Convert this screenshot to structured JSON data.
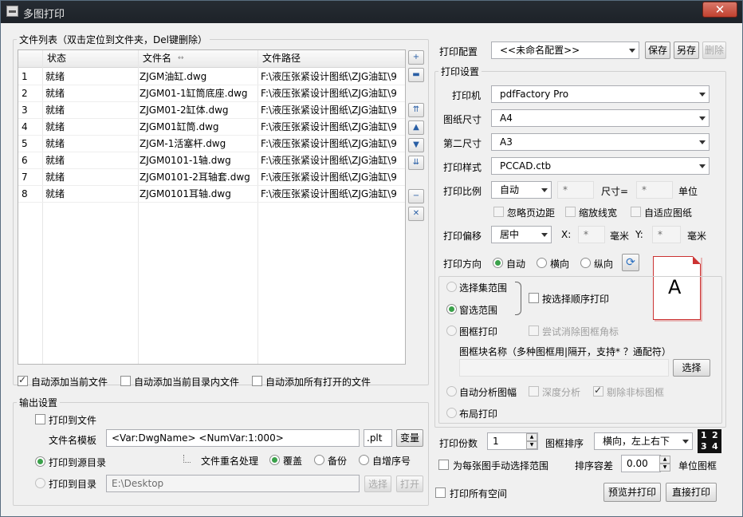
{
  "window": {
    "title": "多图打印",
    "close": "✕"
  },
  "file_list": {
    "legend": "文件列表（双击定位到文件夹，Del键删除）",
    "columns": [
      "状态",
      "文件名",
      "文件路径"
    ],
    "sort_indicator": "↔",
    "rows": [
      {
        "n": "1",
        "status": "就绪",
        "name": "ZJGM油缸.dwg",
        "path": "F:\\液压张紧设计图纸\\ZJG油缸\\9"
      },
      {
        "n": "2",
        "status": "就绪",
        "name": "ZJGM01-1缸筒底座.dwg",
        "path": "F:\\液压张紧设计图纸\\ZJG油缸\\9"
      },
      {
        "n": "3",
        "status": "就绪",
        "name": "ZJGM01-2缸体.dwg",
        "path": "F:\\液压张紧设计图纸\\ZJG油缸\\9"
      },
      {
        "n": "4",
        "status": "就绪",
        "name": "ZJGM01缸筒.dwg",
        "path": "F:\\液压张紧设计图纸\\ZJG油缸\\9"
      },
      {
        "n": "5",
        "status": "就绪",
        "name": "ZJGM-1活塞杆.dwg",
        "path": "F:\\液压张紧设计图纸\\ZJG油缸\\9"
      },
      {
        "n": "6",
        "status": "就绪",
        "name": "ZJGM0101-1轴.dwg",
        "path": "F:\\液压张紧设计图纸\\ZJG油缸\\9"
      },
      {
        "n": "7",
        "status": "就绪",
        "name": "ZJGM0101-2耳轴套.dwg",
        "path": "F:\\液压张紧设计图纸\\ZJG油缸\\9"
      },
      {
        "n": "8",
        "status": "就绪",
        "name": "ZJGM0101耳轴.dwg",
        "path": "F:\\液压张紧设计图纸\\ZJG油缸\\9"
      }
    ],
    "side_buttons": [
      "+",
      "▬",
      "⇈",
      "▲",
      "▼",
      "⇊",
      "−",
      "✕"
    ]
  },
  "auto_add": {
    "current": "自动添加当前文件",
    "dir": "自动添加当前目录内文件",
    "all_open": "自动添加所有打开的文件"
  },
  "output": {
    "legend": "输出设置",
    "print_to_file": "打印到文件",
    "filename_template_label": "文件名模板",
    "filename_template": "<Var:DwgName>  <NumVar:1:000>",
    "ext": ".plt",
    "variable_btn": "变量",
    "print_to_source": "打印到源目录",
    "rename_label": "文件重名处理",
    "overwrite": "覆盖",
    "backup": "备份",
    "auto_increment": "自增序号",
    "print_to_dir": "打印到目录",
    "dir_value": "E:\\Desktop",
    "select_btn": "选择",
    "open_btn": "打开"
  },
  "config": {
    "label": "打印配置",
    "value": "<<未命名配置>>",
    "save": "保存",
    "save_as": "另存",
    "delete": "删除"
  },
  "print_settings": {
    "legend": "打印设置",
    "printer_label": "打印机",
    "printer": "pdfFactory Pro",
    "paper_label": "图纸尺寸",
    "paper": "A4",
    "paper2_label": "第二尺寸",
    "paper2": "A3",
    "style_label": "打印样式",
    "style": "PCCAD.ctb",
    "scale_label": "打印比例",
    "scale": "自动",
    "scale_value": "*",
    "size_label": "尺寸=",
    "size_value": "*",
    "unit_label": "单位",
    "ignore_margin": "忽略页边距",
    "scale_lineweight": "缩放线宽",
    "fit_paper": "自适应图纸",
    "offset_label": "打印偏移",
    "offset": "居中",
    "x_label": "X:",
    "x_value": "*",
    "mm1": "毫米",
    "y_label": "Y:",
    "y_value": "*",
    "mm2": "毫米",
    "orient_label": "打印方向",
    "orient_auto": "自动",
    "orient_land": "横向",
    "orient_port": "纵向",
    "paper_preview": "A"
  },
  "range": {
    "select_set": "选择集范围",
    "window": "窗选范围",
    "by_order": "按选择顺序打印",
    "frame_print": "图框打印",
    "remove_corner": "尝试消除图框角标",
    "block_name_label": "图框块名称（多种图框用|隔开，支持* ？通配符）",
    "block_name": "",
    "select_btn": "选择",
    "auto_analyze": "自动分析图幅",
    "deep_analyze": "深度分析",
    "remove_nonstd": "剔除非标图框",
    "layout_print": "布局打印"
  },
  "bottom": {
    "copies_label": "打印份数",
    "copies": "1",
    "sort_label": "图框排序",
    "sort": "横向，左上右下",
    "sort_grid": [
      "1",
      "2",
      "3",
      "4"
    ],
    "manual_range": "为每张图手动选择范围",
    "tolerance_label": "排序容差",
    "tolerance": "0.00",
    "tolerance_unit": "单位图框",
    "print_all_space": "打印所有空间",
    "preview_print": "预览并打印",
    "start_print": "直接打印"
  },
  "colors": {
    "title_bg": "#1d2228",
    "radio_on": "#3aa14a",
    "paper_border": "#cc3333"
  }
}
